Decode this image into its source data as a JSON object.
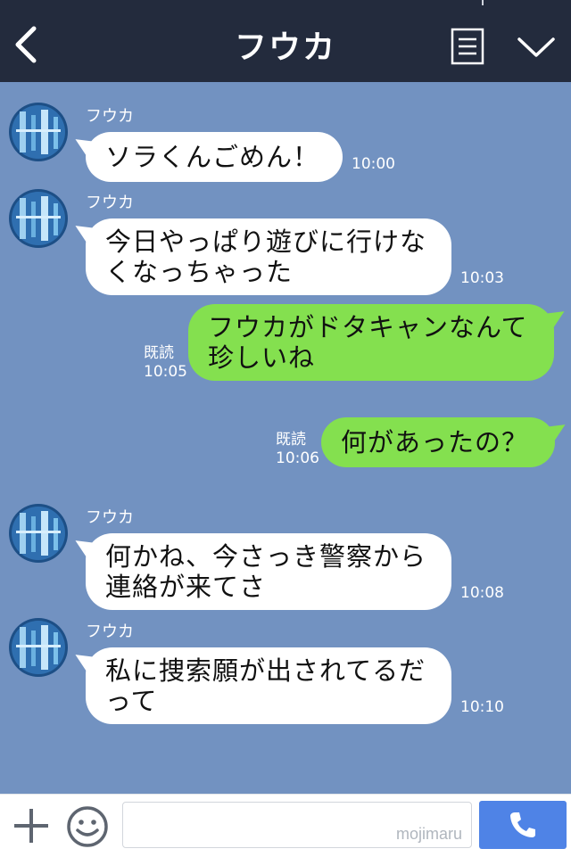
{
  "header": {
    "title": "フウカ"
  },
  "messages": [
    {
      "sender": "フウカ",
      "lines": [
        "ソラくんごめん！"
      ],
      "time": "10:00"
    },
    {
      "sender": "フウカ",
      "lines": [
        "今日やっぱり遊びに行けな",
        "くなっちゃった"
      ],
      "time": "10:03"
    },
    {
      "read": "既読",
      "lines": [
        "フウカがドタキャンなんて",
        "珍しいね"
      ],
      "time": "10:05"
    },
    {
      "read": "既読",
      "lines": [
        "何があったの？"
      ],
      "time": "10:06"
    },
    {
      "sender": "フウカ",
      "lines": [
        "何かね、今さっき警察から",
        "連絡が来てさ"
      ],
      "time": "10:08"
    },
    {
      "sender": "フウカ",
      "lines": [
        "私に捜索願が出されてるだ",
        "って"
      ],
      "time": "10:10"
    }
  ],
  "footer": {
    "watermark": "mojimaru"
  },
  "icons": {
    "back": "chevron-left-icon",
    "menu": "list-icon",
    "collapse": "chevron-down-icon",
    "add": "plus-icon",
    "emoji": "smiley-icon",
    "call": "phone-icon"
  },
  "colors": {
    "header_bg": "#232b3d",
    "chat_bg": "#7292c1",
    "incoming_bubble": "#ffffff",
    "outgoing_bubble": "#84e04f",
    "call_button": "#4f83e6"
  }
}
